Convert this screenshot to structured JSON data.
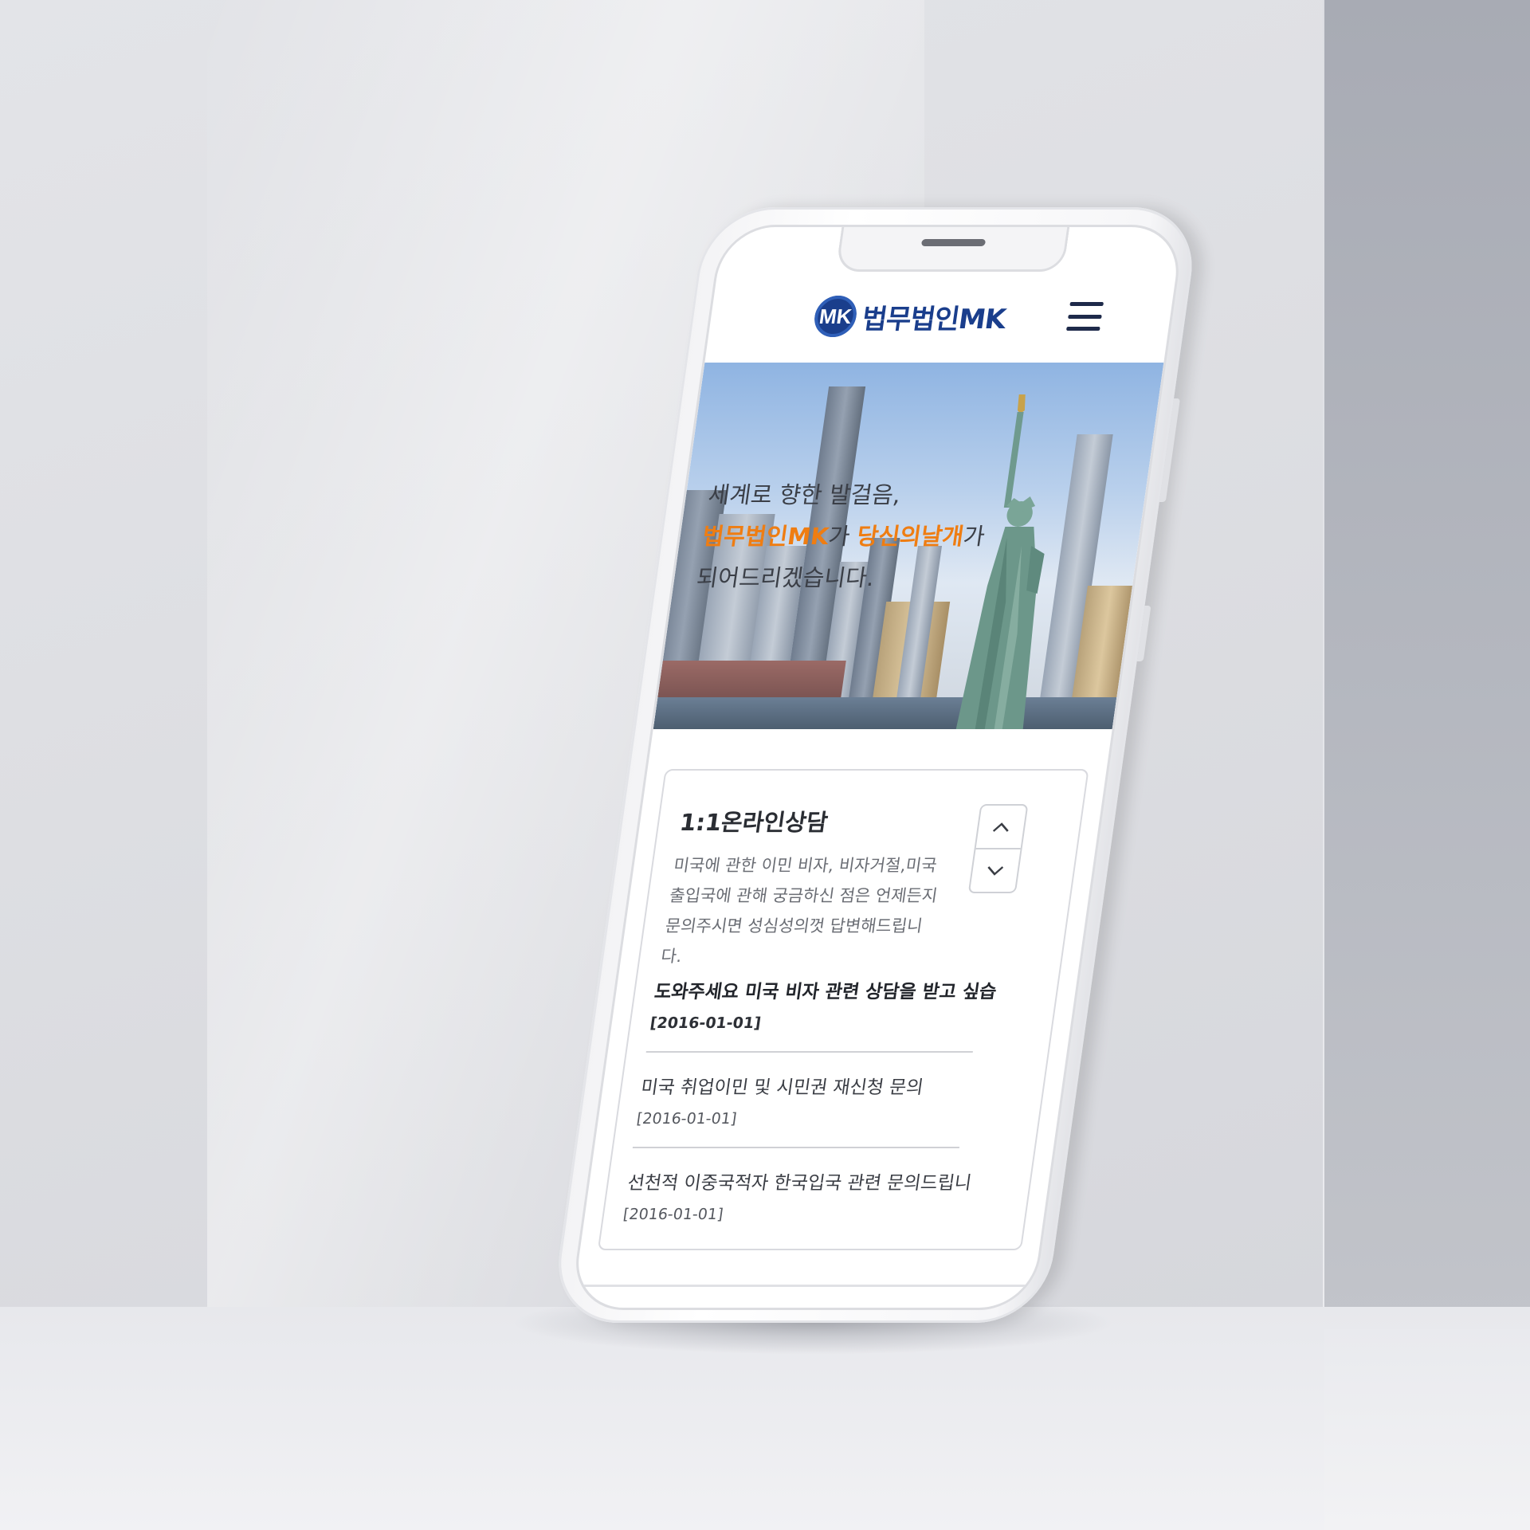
{
  "header": {
    "logo_mark": "MK",
    "logo_text": "법무법인MK"
  },
  "hero": {
    "line1": "세계로 향한 발걸음,",
    "line2_brand": "법무법인MK",
    "line2_mid": "가 ",
    "line2_accent": "당신의날개",
    "line2_end": "가",
    "line3": "되어드리겠습니다.",
    "accent_color": "#ef7d12"
  },
  "consult": {
    "title": "1:1온라인상담",
    "description_lines": [
      "미국에 관한 이민 비자, 비자거절,미국",
      "출입국에 관해 궁금하신 점은 언제든지",
      "문의주시면 성심성의껏 답변해드립니다."
    ],
    "posts": [
      {
        "title": "도와주세요 미국 비자 관련 상담을 받고 싶습...",
        "date": "[2016-01-01]"
      },
      {
        "title": "미국 취업이민 및 시민권 재신청 문의",
        "date": "[2016-01-01]"
      },
      {
        "title": "선천적 이중국적자 한국입국 관련 문의드립니...",
        "date": "[2016-01-01]"
      }
    ]
  },
  "icons": {
    "menu": "hamburger-menu-icon",
    "up": "chevron-up-icon",
    "down": "chevron-down-icon"
  },
  "colors": {
    "brand": "#1a3e8c",
    "accent": "#ef7d12"
  }
}
